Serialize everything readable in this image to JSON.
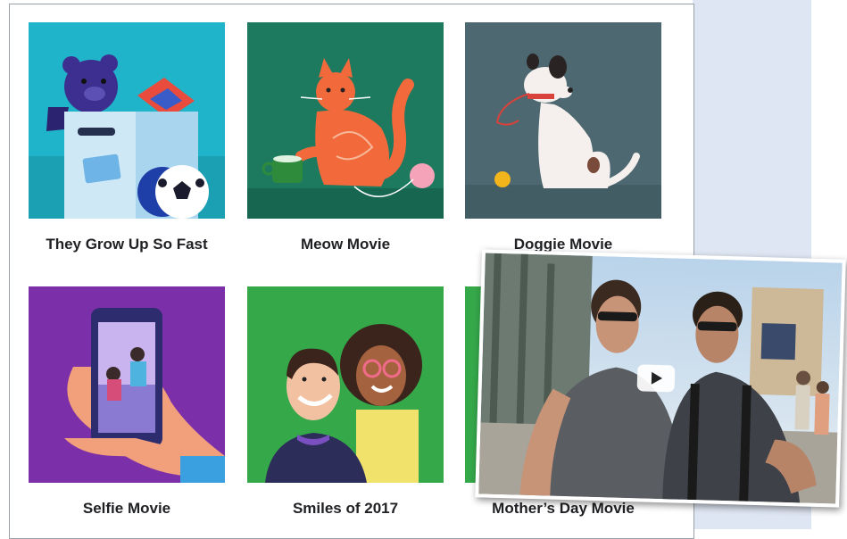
{
  "movies": [
    {
      "title": "They Grow Up So Fast",
      "icon": "teddy-bear-toy-box-icon",
      "bg": "#1fb4c9"
    },
    {
      "title": "Meow Movie",
      "icon": "cat-with-yarn-icon",
      "bg": "#1d7a5f"
    },
    {
      "title": "Doggie Movie",
      "icon": "dog-with-ball-icon",
      "bg": "#4d6870"
    },
    {
      "title": "Selfie Movie",
      "icon": "phone-selfie-icon",
      "bg": "#7b2fa8"
    },
    {
      "title": "Smiles of 2017",
      "icon": "smiling-couple-icon",
      "bg": "#35a84a"
    },
    {
      "title": "Mother’s Day Movie",
      "icon": "mothers-day-icon",
      "bg": "#35a84a"
    }
  ],
  "video": {
    "icon": "play-icon"
  }
}
